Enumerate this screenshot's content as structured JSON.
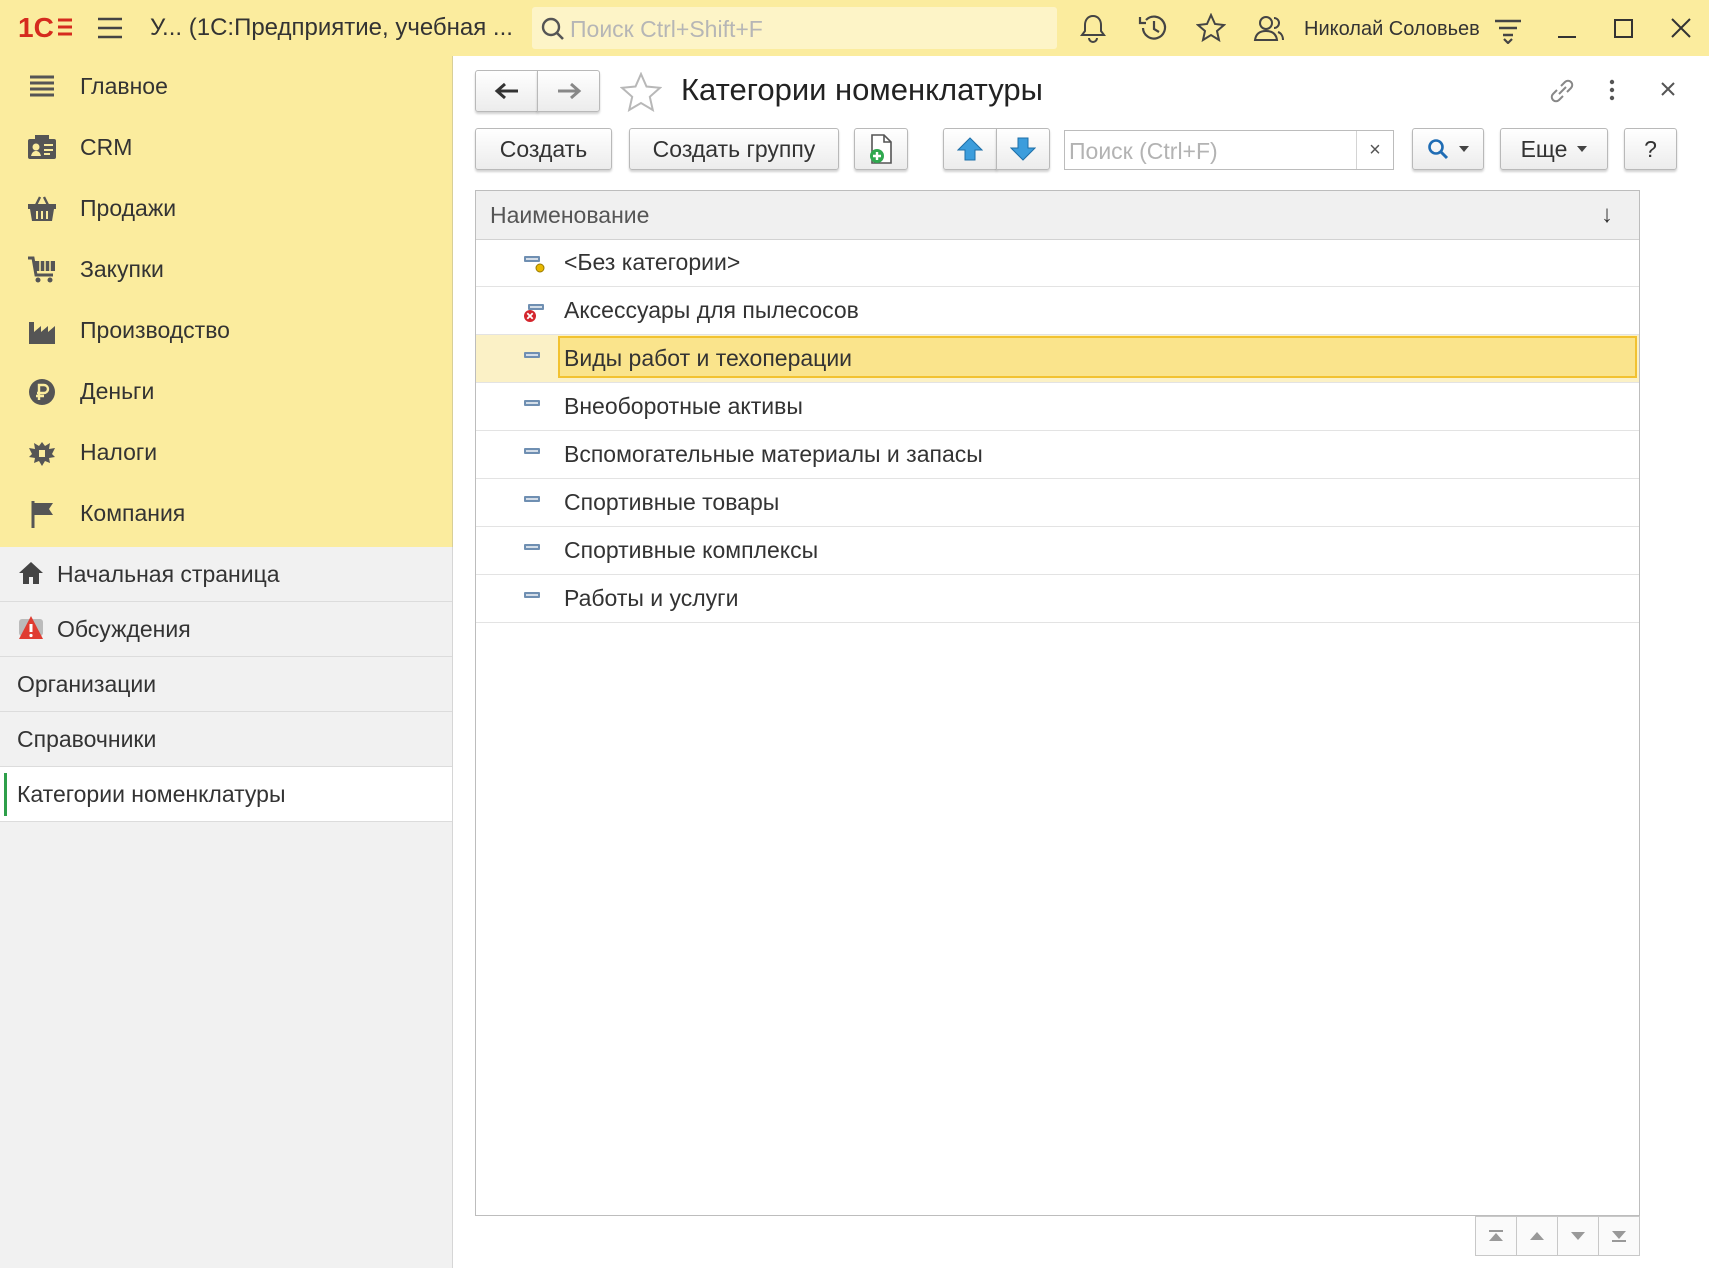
{
  "app": {
    "title": "У... (1С:Предприятие, учебная ...",
    "search_placeholder": "Поиск Ctrl+Shift+F",
    "user_name": "Николай Соловьев",
    "accent_color": "#fbec9e"
  },
  "sections": [
    {
      "label": "Главное",
      "icon": "menu-lines-icon"
    },
    {
      "label": "CRM",
      "icon": "contact-card-icon"
    },
    {
      "label": "Продажи",
      "icon": "basket-icon"
    },
    {
      "label": "Закупки",
      "icon": "cart-icon"
    },
    {
      "label": "Производство",
      "icon": "factory-icon"
    },
    {
      "label": "Деньги",
      "icon": "ruble-icon"
    },
    {
      "label": "Налоги",
      "icon": "eagle-emblem-icon"
    },
    {
      "label": "Компания",
      "icon": "flag-icon"
    }
  ],
  "nav": {
    "home": "Начальная страница",
    "discussions": "Обсуждения",
    "organizations": "Организации",
    "catalogs": "Справочники",
    "current": "Категории номенклатуры"
  },
  "form": {
    "title": "Категории номенклатуры",
    "create_label": "Создать",
    "create_group_label": "Создать группу",
    "search_placeholder": "Поиск (Ctrl+F)",
    "clear_label": "×",
    "more_label": "Еще",
    "help_label": "?"
  },
  "table": {
    "column": "Наименование",
    "sort_indicator": "↓",
    "rows": [
      {
        "name": "<Без категории>",
        "icon": "item-default-icon",
        "selected": false
      },
      {
        "name": "Аксессуары для пылесосов",
        "icon": "item-deleted-icon",
        "selected": false
      },
      {
        "name": "Виды работ и техоперации",
        "icon": "item-icon",
        "selected": true
      },
      {
        "name": "Внеоборотные активы",
        "icon": "item-icon",
        "selected": false
      },
      {
        "name": "Вспомогательные материалы и запасы",
        "icon": "item-icon",
        "selected": false
      },
      {
        "name": "Спортивные товары",
        "icon": "item-icon",
        "selected": false
      },
      {
        "name": "Спортивные комплексы",
        "icon": "item-icon",
        "selected": false
      },
      {
        "name": "Работы и услуги",
        "icon": "item-icon",
        "selected": false
      }
    ]
  }
}
